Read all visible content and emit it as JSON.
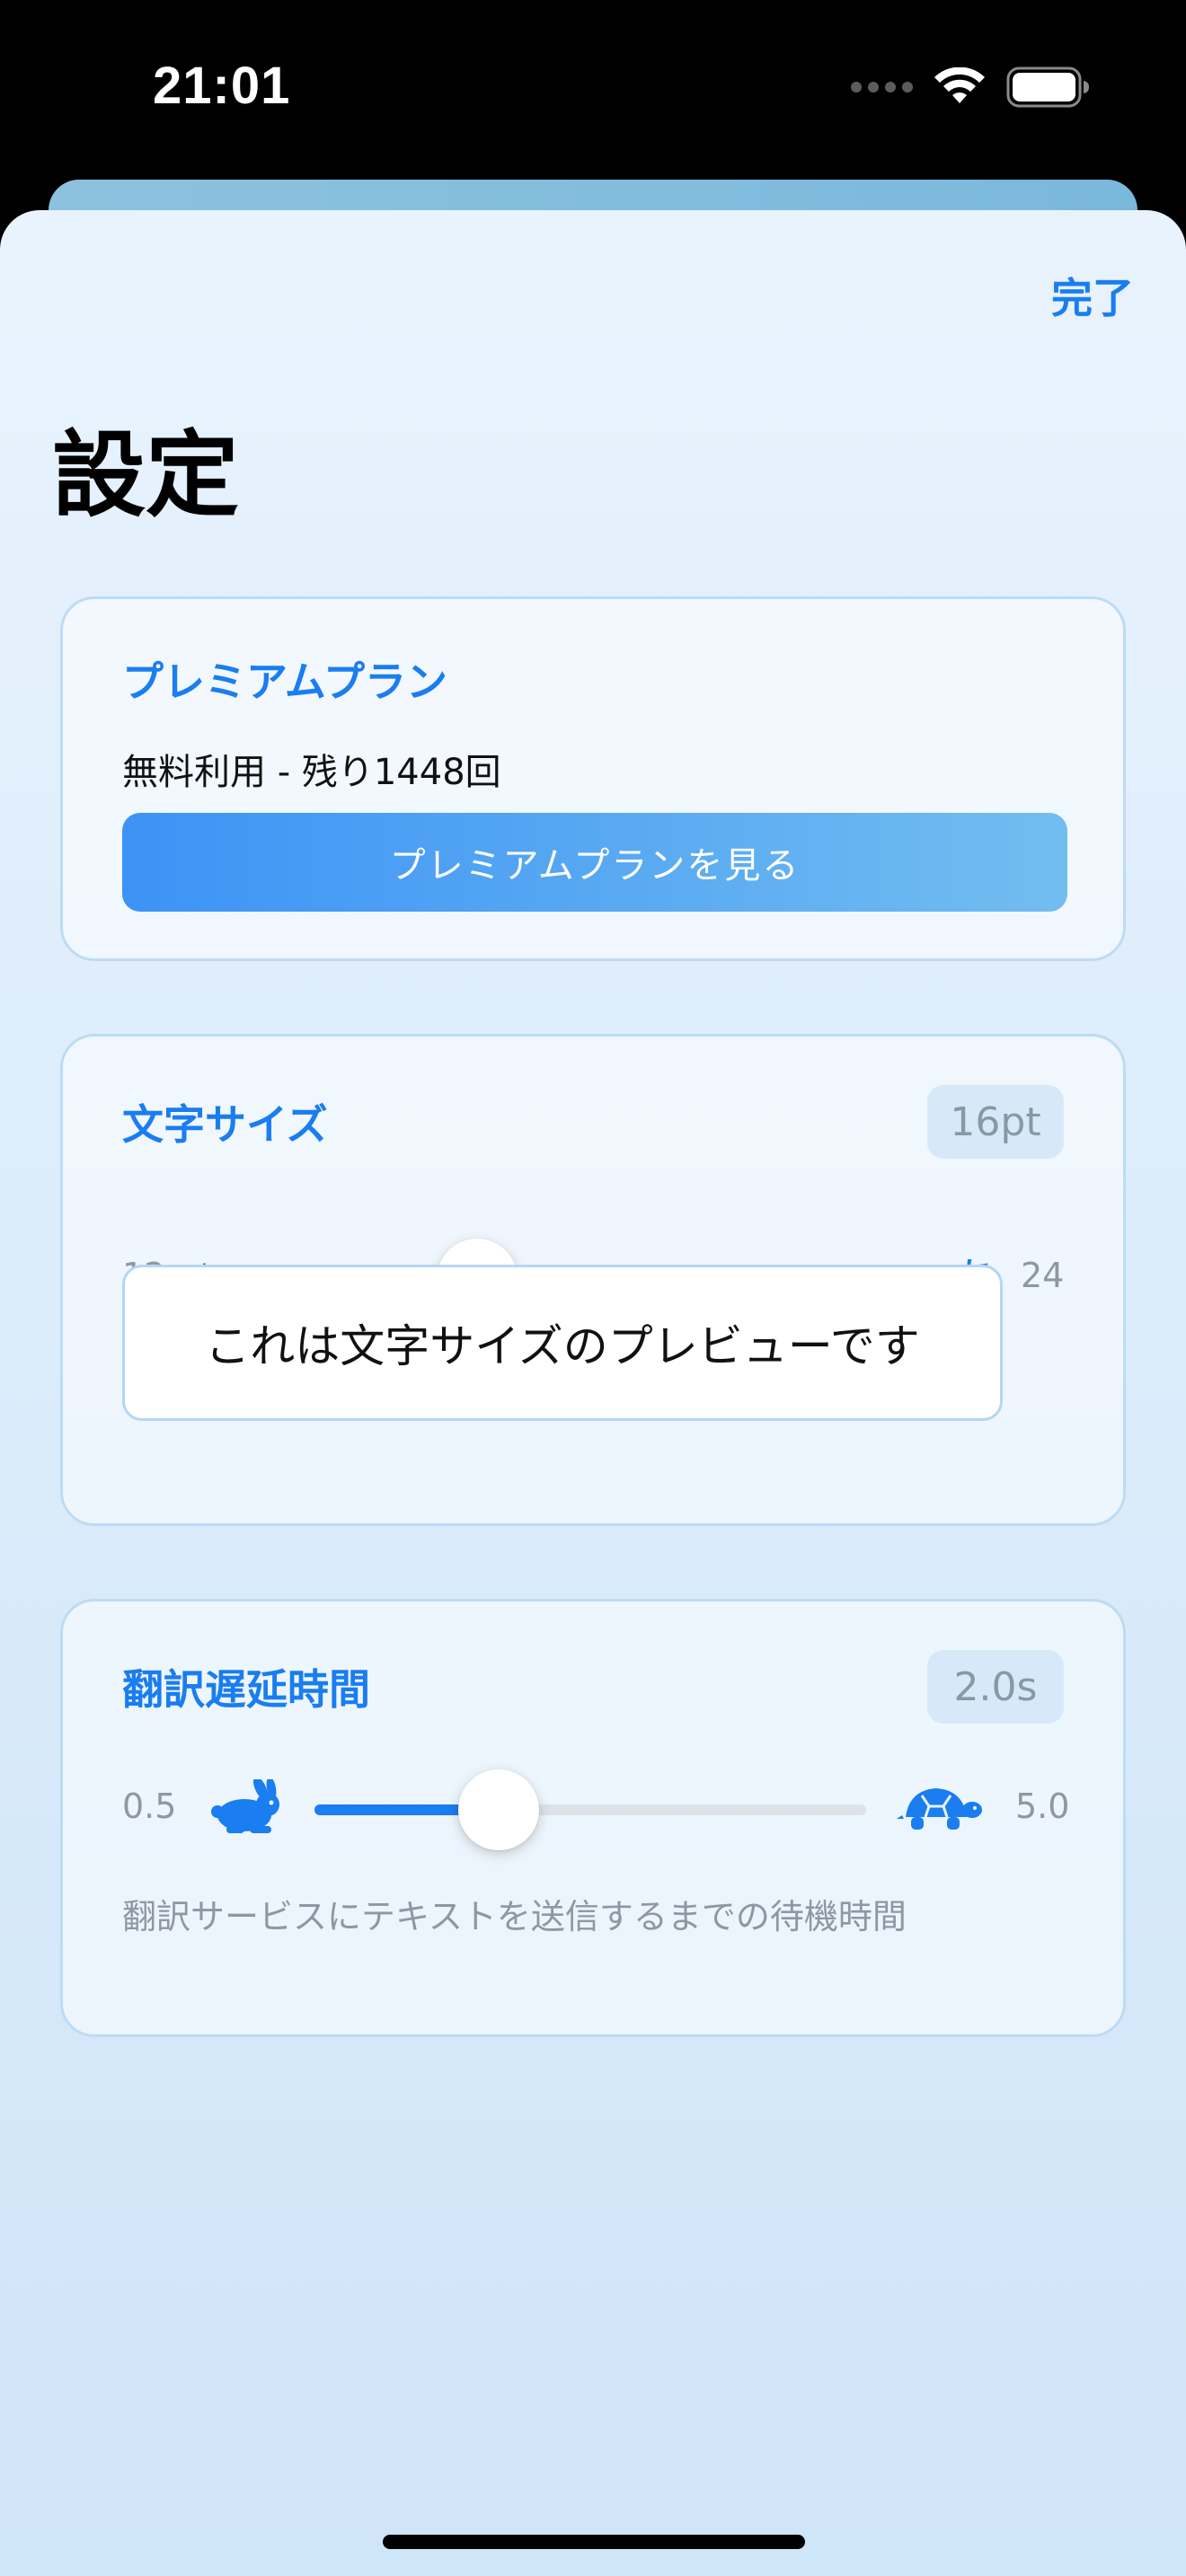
{
  "status_bar": {
    "time": "21:01"
  },
  "header": {
    "done_label": "完了",
    "title": "設定"
  },
  "premium": {
    "title": "プレミアムプラン",
    "usage_text": "無料利用 - 残り1448回",
    "button_label": "プレミアムプランを見る"
  },
  "font_size": {
    "title": "文字サイズ",
    "value_label": "16pt",
    "min_label": "12",
    "max_label": "24",
    "small_glyph": "あ",
    "large_glyph": "あ",
    "min": 12,
    "max": 24,
    "value": 16,
    "preview_text": "これは文字サイズのプレビューです"
  },
  "translation_delay": {
    "title": "翻訳遅延時間",
    "value_label": "2.0s",
    "min_label": "0.5",
    "max_label": "5.0",
    "min": 0.5,
    "max": 5.0,
    "value": 2.0,
    "fast_icon": "rabbit-icon",
    "slow_icon": "tortoise-icon",
    "hint": "翻訳サービスにテキストを送信するまでの待機時間"
  },
  "colors": {
    "accent": "#1a7df0",
    "badge_bg": "#d7e9f8",
    "sheet_top": "#e8f3fd",
    "sheet_bottom": "#cfe5f8"
  }
}
